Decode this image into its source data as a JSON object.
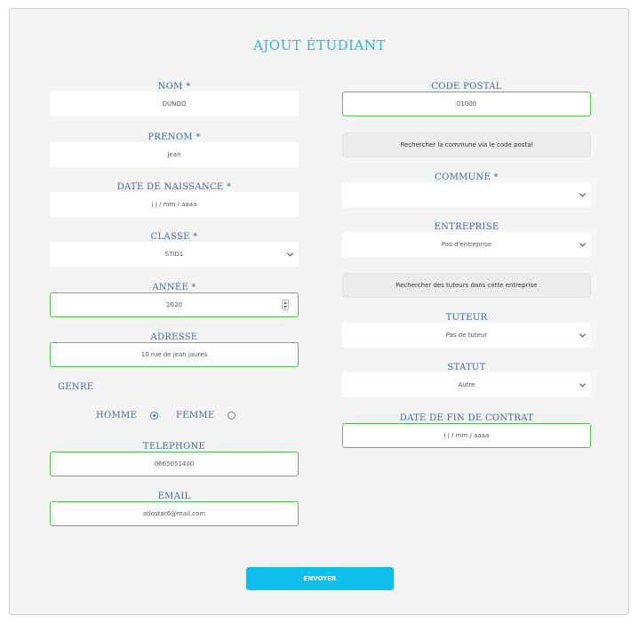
{
  "form": {
    "title": "AJOUT ÉTUDIANT",
    "left": {
      "nom_label": "NOM *",
      "nom_value": "DUNOD",
      "prenom_label": "PRENOM *",
      "prenom_value": "Jean",
      "date_naissance_label": "DATE DE NAISSANCE *",
      "date_naissance_placeholder": "j j / mm / aaaa",
      "classe_label": "CLASSE *",
      "classe_value": "STID1",
      "annee_label": "ANNÉE *",
      "annee_value": "2020",
      "adresse_label": "ADRESSE",
      "adresse_value": "10 rue de jean jaures",
      "genre_label": "GENRE",
      "homme_label": "HOMME",
      "femme_label": "FEMME",
      "genre_selected": "HOMME",
      "telephone_label": "TELEPHONE",
      "telephone_value": "0665051400",
      "email_label": "EMAIL",
      "email_value": "atlostar6@mail.com"
    },
    "right": {
      "code_postal_label": "CODE POSTAL",
      "code_postal_value": "01000",
      "search_commune_button": "Rechercher la commune via le code postal",
      "commune_label": "COMMUNE *",
      "commune_value": "",
      "entreprise_label": "ENTREPRISE",
      "entreprise_value": "Pas d'entreprise",
      "search_tuteurs_button": "Rechercher des tuteurs dans cette entreprise",
      "tuteur_label": "TUTEUR",
      "tuteur_value": "Pas de tuteur",
      "statut_label": "STATUT",
      "statut_value": "Autre",
      "date_fin_label": "DATE DE FIN DE CONTRAT",
      "date_fin_placeholder": "j j / mm / aaaa"
    },
    "submit_label": "ENVOYER"
  },
  "colors": {
    "title": "#29b6e6",
    "label": "#3d6aa6",
    "valid_border": "#4fc24f",
    "submit_bg": "#0fc0ef",
    "card_bg": "#f4f4f4"
  },
  "icons": [
    "chevron-down-icon",
    "number-spinner-icon",
    "radio-icon"
  ]
}
